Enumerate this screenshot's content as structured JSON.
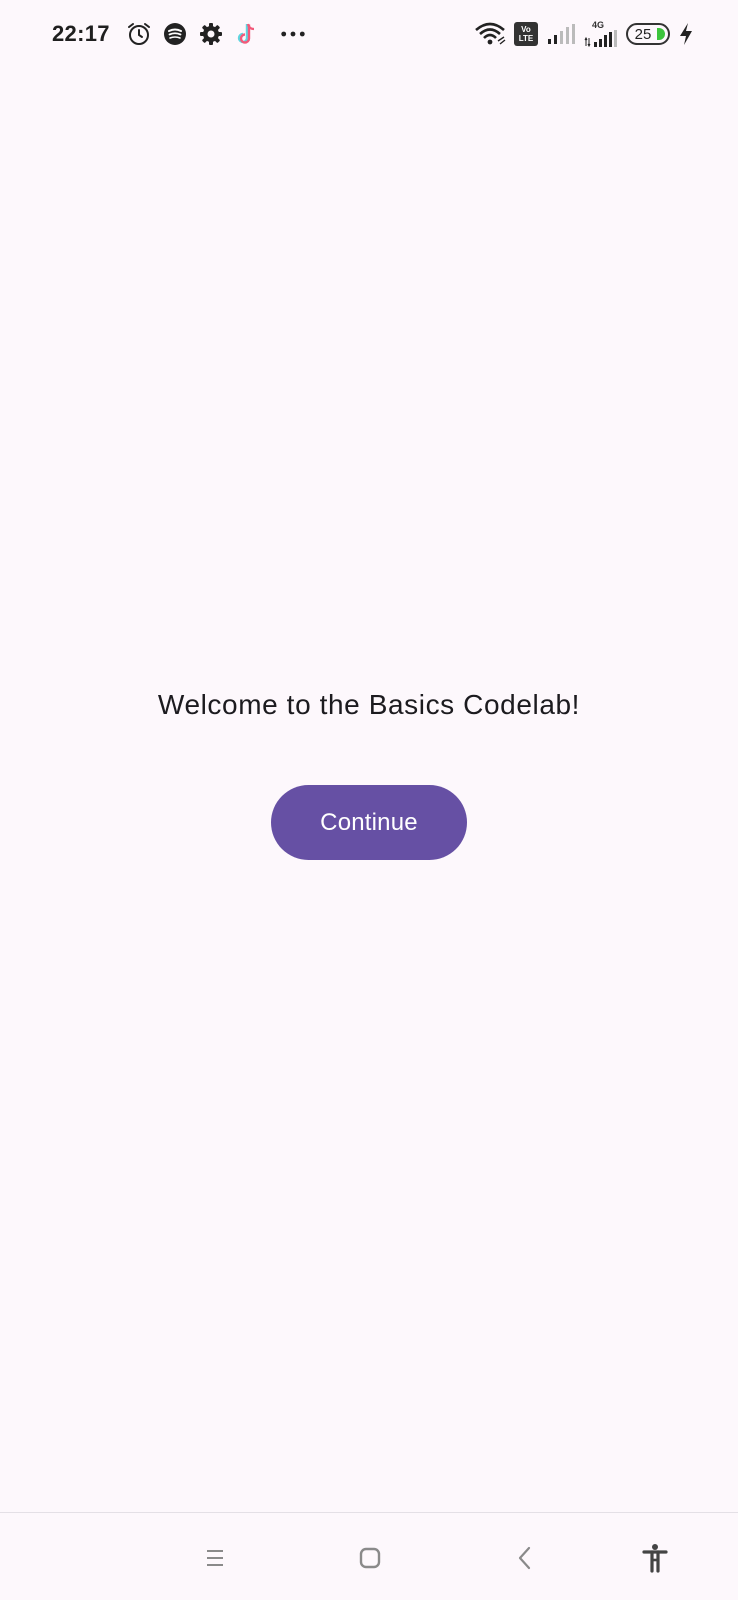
{
  "status_bar": {
    "time": "22:17",
    "left_icons": [
      "alarm-icon",
      "spotify-icon",
      "settings-icon",
      "tiktok-icon",
      "more-notifications-icon"
    ],
    "volte_top": "Vo",
    "volte_bottom": "LTE",
    "network_type": "4G",
    "battery_level": "25",
    "charging": true
  },
  "main": {
    "welcome_text": "Welcome to the Basics Codelab!",
    "continue_label": "Continue"
  },
  "colors": {
    "background": "#fdf8fc",
    "primary": "#6650a4",
    "on_primary": "#ffffff",
    "text": "#1c1b1f"
  },
  "nav_bar": {
    "buttons": [
      "menu-icon",
      "home-icon",
      "back-icon",
      "accessibility-icon"
    ]
  }
}
